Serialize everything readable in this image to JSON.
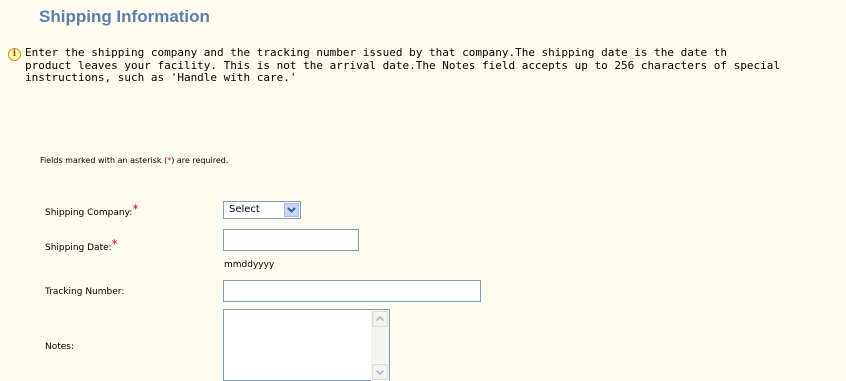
{
  "page_title": "Shipping Information",
  "info": {
    "icon": "info-icon",
    "line1": "Enter the shipping company and the tracking number issued by that company.The shipping date is the date th",
    "line2": "product leaves your facility. This is not the arrival date.The Notes field accepts up to 256 characters of special",
    "line3": "instructions, such as 'Handle with care.'"
  },
  "required_note": {
    "prefix": "Fields marked with an asterisk (",
    "asterisk": "*",
    "suffix": ") are required."
  },
  "fields": {
    "shipping_company": {
      "label": "Shipping Company:",
      "asterisk": "*",
      "selected_value": "Select"
    },
    "shipping_date": {
      "label": "Shipping Date:",
      "asterisk": "*",
      "value": "",
      "hint": "mmddyyyy"
    },
    "tracking_number": {
      "label": "Tracking Number:",
      "value": ""
    },
    "notes": {
      "label": "Notes:",
      "value": ""
    }
  },
  "colors": {
    "background": "#fffcf0",
    "title": "#5a7fb0",
    "required_asterisk": "#e01010",
    "input_border": "#7f9db9"
  }
}
